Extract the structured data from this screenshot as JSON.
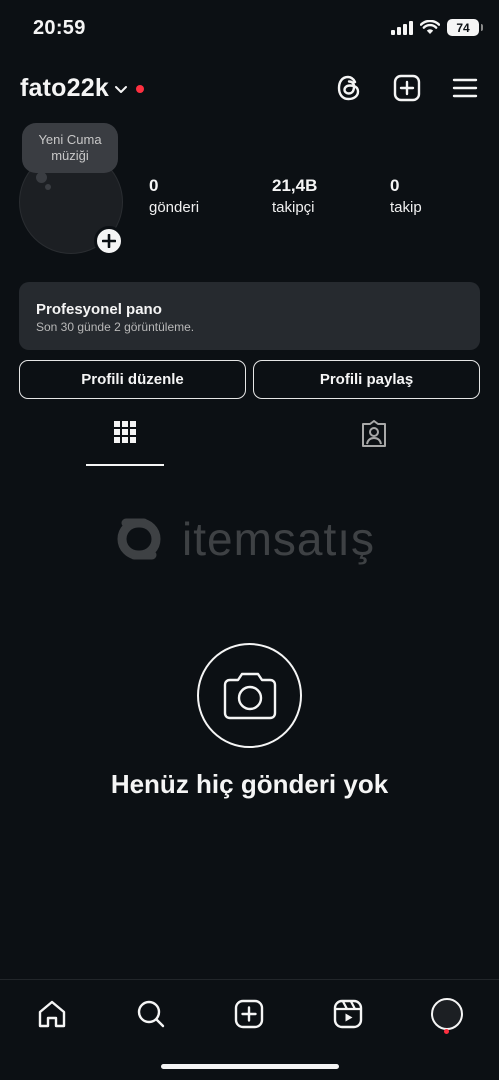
{
  "status_bar": {
    "time": "20:59",
    "battery": "74"
  },
  "header": {
    "username": "fato22k"
  },
  "note": {
    "text": "Yeni Cuma müziği"
  },
  "stats": {
    "posts": {
      "value": "0",
      "label": "gönderi"
    },
    "followers": {
      "value": "21,4B",
      "label": "takipçi"
    },
    "following": {
      "value": "0",
      "label": "takip"
    }
  },
  "dashboard": {
    "title": "Profesyonel pano",
    "subtitle": "Son 30 günde 2 görüntüleme."
  },
  "buttons": {
    "edit": "Profili düzenle",
    "share": "Profili paylaş"
  },
  "watermark": {
    "text": "itemsatış"
  },
  "empty_state": {
    "text": "Henüz hiç gönderi yok"
  },
  "colors": {
    "background": "#0c1014",
    "notification": "#ff3040",
    "card": "#262a2f"
  },
  "icons": {
    "header": [
      "threads-icon",
      "create-post-icon",
      "menu-icon"
    ],
    "nav": [
      "home-icon",
      "search-icon",
      "create-icon",
      "reels-icon",
      "profile-avatar"
    ]
  }
}
